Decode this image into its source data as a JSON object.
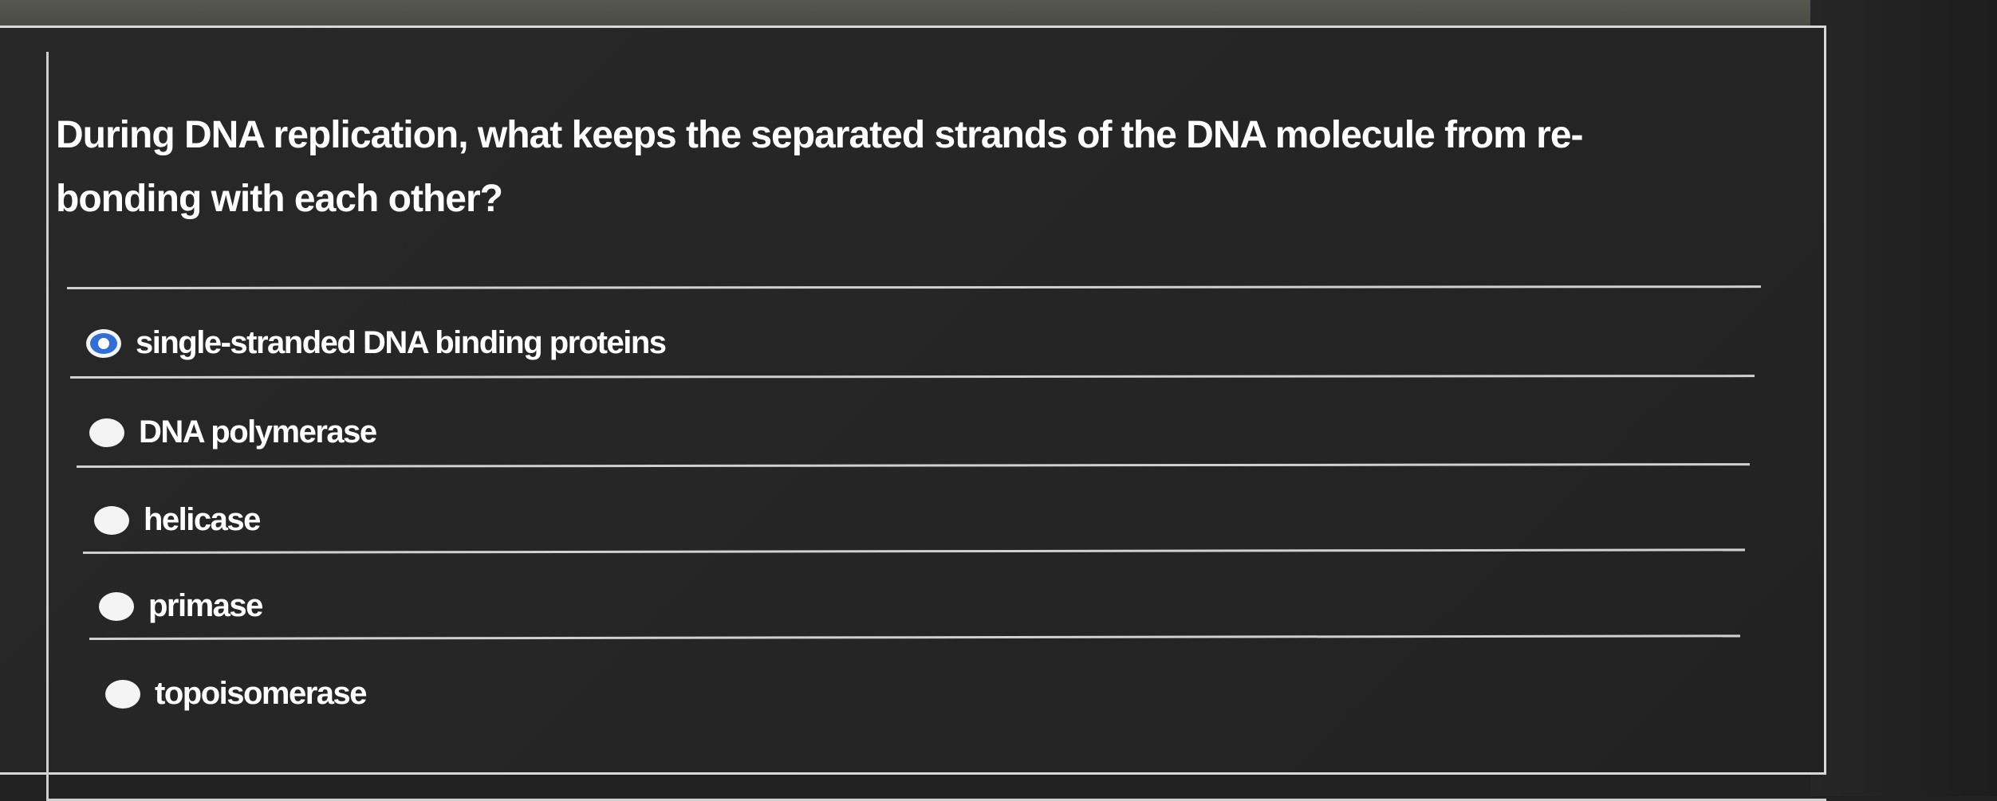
{
  "question": {
    "text": "During DNA replication, what keeps the separated strands of the DNA molecule from re-bonding with each other?"
  },
  "options": [
    {
      "label": "single-stranded DNA binding proteins",
      "selected": true
    },
    {
      "label": "DNA polymerase",
      "selected": false
    },
    {
      "label": "helicase",
      "selected": false
    },
    {
      "label": "primase",
      "selected": false
    },
    {
      "label": "topoisomerase",
      "selected": false
    }
  ],
  "colors": {
    "background": "#212121",
    "text": "#ffffff",
    "divider": "#d0d0d0",
    "selected_radio": "#2f6fd6"
  }
}
